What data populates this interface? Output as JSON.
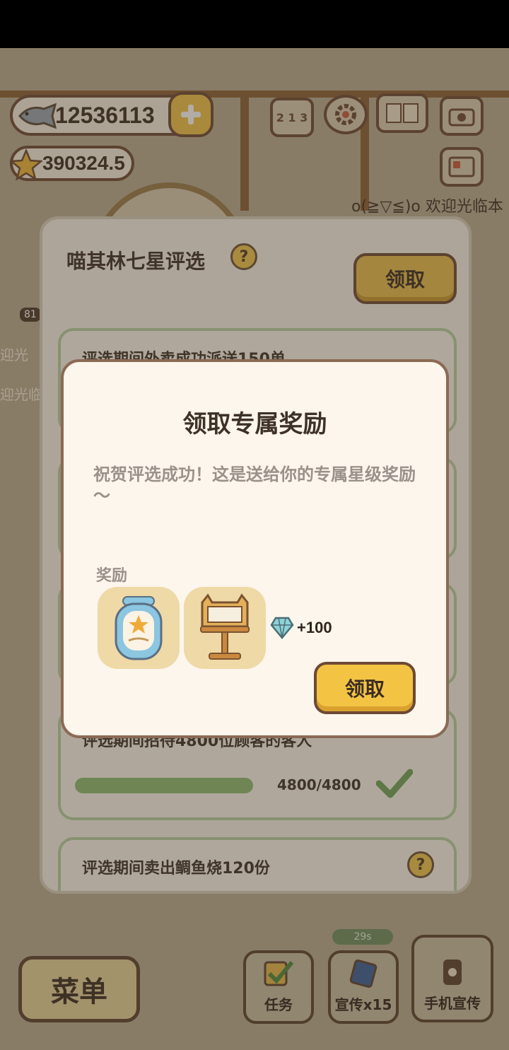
{
  "hud": {
    "fish_currency": "12536113",
    "star_currency": "390324.5",
    "marquee_text": "o(≧▽≦)o 欢迎光临本",
    "side_text_1": "迎光",
    "side_text_2": "迎光临",
    "side_badge": "81",
    "rank_icon_label": "2 1 3"
  },
  "panel": {
    "title": "喵其林七星评选",
    "claim_label": "领取",
    "tasks": [
      {
        "text": "评选期间外卖成功派送150单"
      },
      {
        "text": "评选期间招待4800位顾客的客人",
        "progress": "4800/4800",
        "complete": true
      },
      {
        "text": "评选期间卖出鲷鱼烧120份"
      }
    ]
  },
  "dialog": {
    "title": "领取专属奖励",
    "message": "祝贺评选成功！这是送给你的专属星级奖励～",
    "reward_label": "奖励",
    "gem_amount": "+100",
    "claim_label": "领取"
  },
  "bottom_bar": {
    "menu_label": "菜单",
    "task_label": "任务",
    "promo_label": "宣传x15",
    "phone_promo_label": "手机宣传",
    "timer": "29s"
  },
  "colors": {
    "accent_yellow": "#f3c443",
    "border_brown": "#6d4934",
    "progress_green": "#8ebd72",
    "card_border_green": "#b7d3a3"
  }
}
